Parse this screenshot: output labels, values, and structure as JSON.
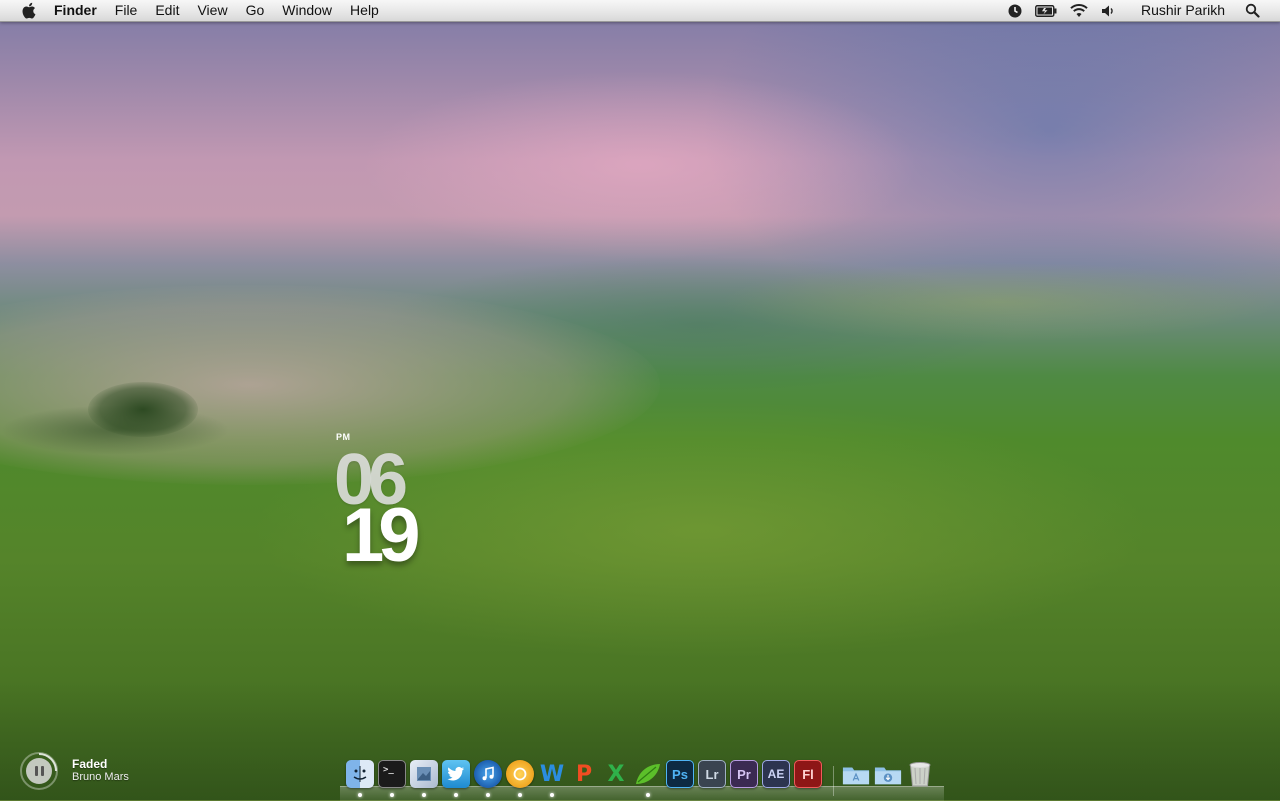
{
  "menubar": {
    "app_name": "Finder",
    "items": [
      "File",
      "Edit",
      "View",
      "Go",
      "Window",
      "Help"
    ],
    "user_name": "Rushir Parikh",
    "status_icons": [
      "time-machine-icon",
      "battery-icon",
      "wifi-icon",
      "volume-icon",
      "spotlight-icon"
    ]
  },
  "clock": {
    "ampm": "PM",
    "hour": "06",
    "minute": "19"
  },
  "now_playing": {
    "title": "Faded",
    "artist": "Bruno Mars",
    "state_icon": "pause-icon"
  },
  "dock": {
    "apps": [
      {
        "name": "finder",
        "running": true
      },
      {
        "name": "terminal",
        "running": true
      },
      {
        "name": "preview",
        "running": true
      },
      {
        "name": "twitter",
        "running": true
      },
      {
        "name": "itunes",
        "running": true
      },
      {
        "name": "chrome",
        "running": true
      },
      {
        "name": "word",
        "label": "W",
        "running": true
      },
      {
        "name": "powerpoint",
        "label": "P",
        "running": false
      },
      {
        "name": "excel",
        "label": "X",
        "running": false
      },
      {
        "name": "growl",
        "running": true
      },
      {
        "name": "photoshop",
        "label": "Ps",
        "running": false
      },
      {
        "name": "lightroom",
        "label": "Lr",
        "running": false
      },
      {
        "name": "premiere",
        "label": "Pr",
        "running": false
      },
      {
        "name": "after-effects",
        "label": "AE",
        "running": false
      },
      {
        "name": "flash",
        "label": "Fl",
        "running": false
      }
    ],
    "stacks": [
      "applications-folder",
      "downloads-folder",
      "trash"
    ]
  }
}
